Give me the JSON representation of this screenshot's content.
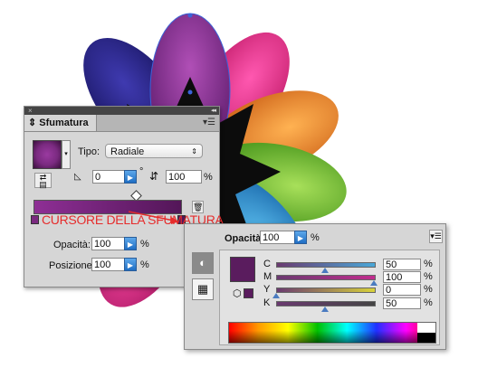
{
  "gradient_panel": {
    "title": "Sfumatura",
    "menu_icon": "panel-menu-icon",
    "tipo_label": "Tipo:",
    "tipo_value": "Radiale",
    "angle_value": "0",
    "degree_symbol": "°",
    "aspect_value": "100",
    "aspect_unit": "%",
    "opacity_label": "Opacità:",
    "opacity_value": "100",
    "opacity_unit": "%",
    "position_label": "Posizione:",
    "position_value": "100",
    "position_unit": "%",
    "gradient_start_color": "#8e2f95",
    "gradient_end_color": "#531658"
  },
  "annotation": {
    "text": "CURSORE DELLA SFUMATURA",
    "color": "#e62c2c"
  },
  "color_panel": {
    "opacity_label": "Opacità:",
    "opacity_value": "100",
    "opacity_unit": "%",
    "swatch_color": "#5a1c5e",
    "sliders": [
      {
        "label": "C",
        "value": "50",
        "unit": "%",
        "fraction": 0.5
      },
      {
        "label": "M",
        "value": "100",
        "unit": "%",
        "fraction": 1.0
      },
      {
        "label": "Y",
        "value": "0",
        "unit": "%",
        "fraction": 0.0
      },
      {
        "label": "K",
        "value": "50",
        "unit": "%",
        "fraction": 0.5
      }
    ]
  }
}
